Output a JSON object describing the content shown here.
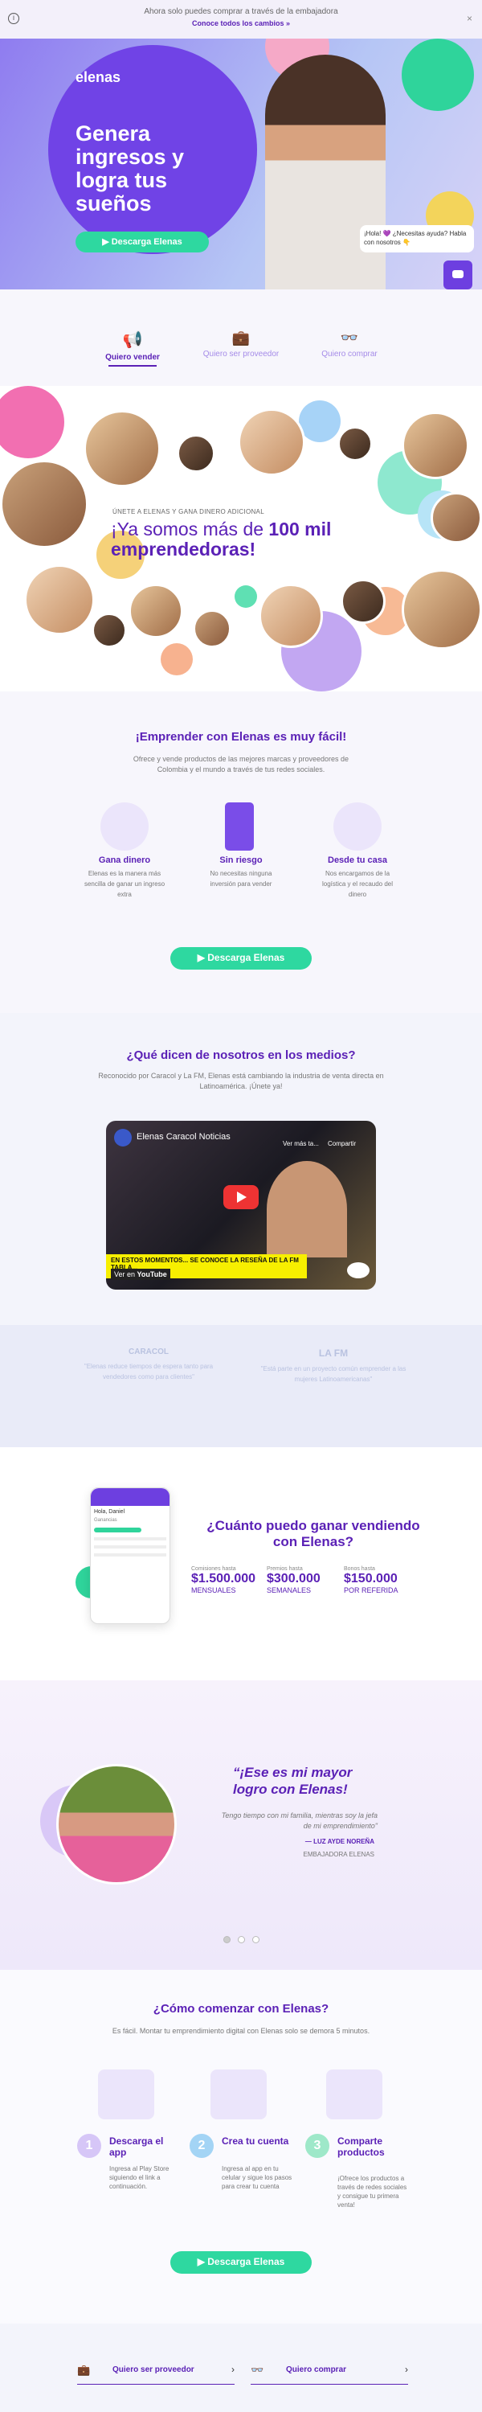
{
  "banner": {
    "text": "Ahora solo puedes comprar a través de la embajadora",
    "link": "Conoce todos los cambios »"
  },
  "hero": {
    "logo": "elenas",
    "headline": "Genera ingresos y logra tus sueños",
    "cta": "Descarga Elenas",
    "chat": "¡Hola! 💜 ¿Necesitas ayuda? Habla con nosotros 👇"
  },
  "roles": [
    {
      "label": "Quiero vender"
    },
    {
      "label": "Quiero ser proveedor"
    },
    {
      "label": "Quiero comprar"
    }
  ],
  "community": {
    "kicker": "ÚNETE A ELENAS Y GANA DINERO ADICIONAL",
    "line1": "¡Ya somos más de ",
    "bold": "100 mil",
    "line2": "emprendedoras!"
  },
  "easy": {
    "title": "¡Emprender con Elenas es muy fácil!",
    "subtitle": "Ofrece y vende productos de las mejores marcas y proveedores de Colombia y el mundo a través de tus redes sociales.",
    "features": [
      {
        "title": "Gana dinero",
        "text": "Elenas es la manera más sencilla de ganar un ingreso extra"
      },
      {
        "title": "Sin riesgo",
        "text": "No necesitas ninguna inversión para vender"
      },
      {
        "title": "Desde tu casa",
        "text": "Nos encargamos de la logística y el recaudo del dinero"
      }
    ],
    "cta": "Descarga Elenas"
  },
  "media": {
    "title": "¿Qué dicen de nosotros en los medios?",
    "subtitle": "Reconocido por Caracol y La FM, Elenas está cambiando la industria de venta directa en Latinoamérica. ¡Únete ya!",
    "video_title": "Elenas Caracol Noticias",
    "watch_later": "Ver más ta...",
    "share": "Compartir",
    "watch_on": "Ver en",
    "youtube": "YouTube",
    "ticker": "EN ESTOS MOMENTOS... SE CONOCE LA RESEÑA DE LA FM  TABLA...",
    "caracol": "CARACOL",
    "lafm": "LA FM",
    "quote1": "\"Elenas reduce tiempos de espera tanto para vendedores como para clientes\"",
    "quote2": "\"Está parte en un proyecto común emprender a las mujeres Latinoamericanas\""
  },
  "earn": {
    "title": "¿Cuánto puedo ganar vendiendo con Elenas?",
    "stats": [
      {
        "label": "Comisiones hasta",
        "value": "$1.500.000",
        "unit": "MENSUALES"
      },
      {
        "label": "Premios hasta",
        "value": "$300.000",
        "unit": "SEMANALES"
      },
      {
        "label": "Bonos hasta",
        "value": "$150.000",
        "unit": "POR REFERIDA"
      }
    ],
    "app_greeting": "Hola, Daniel",
    "app_balance": "Ganancias"
  },
  "testimonial": {
    "quote": "“¡Ese es mi mayor logro con Elenas!",
    "text": "Tengo tiempo con mi familia, mientras soy la jefa de mi emprendimiento\"",
    "name": "— LUZ AYDE NOREÑA",
    "role": "EMBAJADORA ELENAS"
  },
  "start": {
    "title": "¿Cómo comenzar con Elenas?",
    "subtitle": "Es fácil. Montar tu emprendimiento digital con Elenas solo se demora 5 minutos.",
    "steps": [
      {
        "n": "1",
        "title": "Descarga el app",
        "text": "Ingresa al Play Store siguiendo el link a continuación."
      },
      {
        "n": "2",
        "title": "Crea tu cuenta",
        "text": "Ingresa al app en tu celular y sigue los pasos para crear tu cuenta"
      },
      {
        "n": "3",
        "title": "Comparte productos",
        "text": "¡Ofrece los productos a través de redes sociales y consigue tu primera venta!"
      }
    ],
    "cta": "Descarga Elenas"
  },
  "footer_links": [
    {
      "label": "Quiero ser proveedor"
    },
    {
      "label": "Quiero comprar"
    }
  ],
  "colors": {
    "purple": "#6d3fe0",
    "green": "#2ed8a0"
  }
}
